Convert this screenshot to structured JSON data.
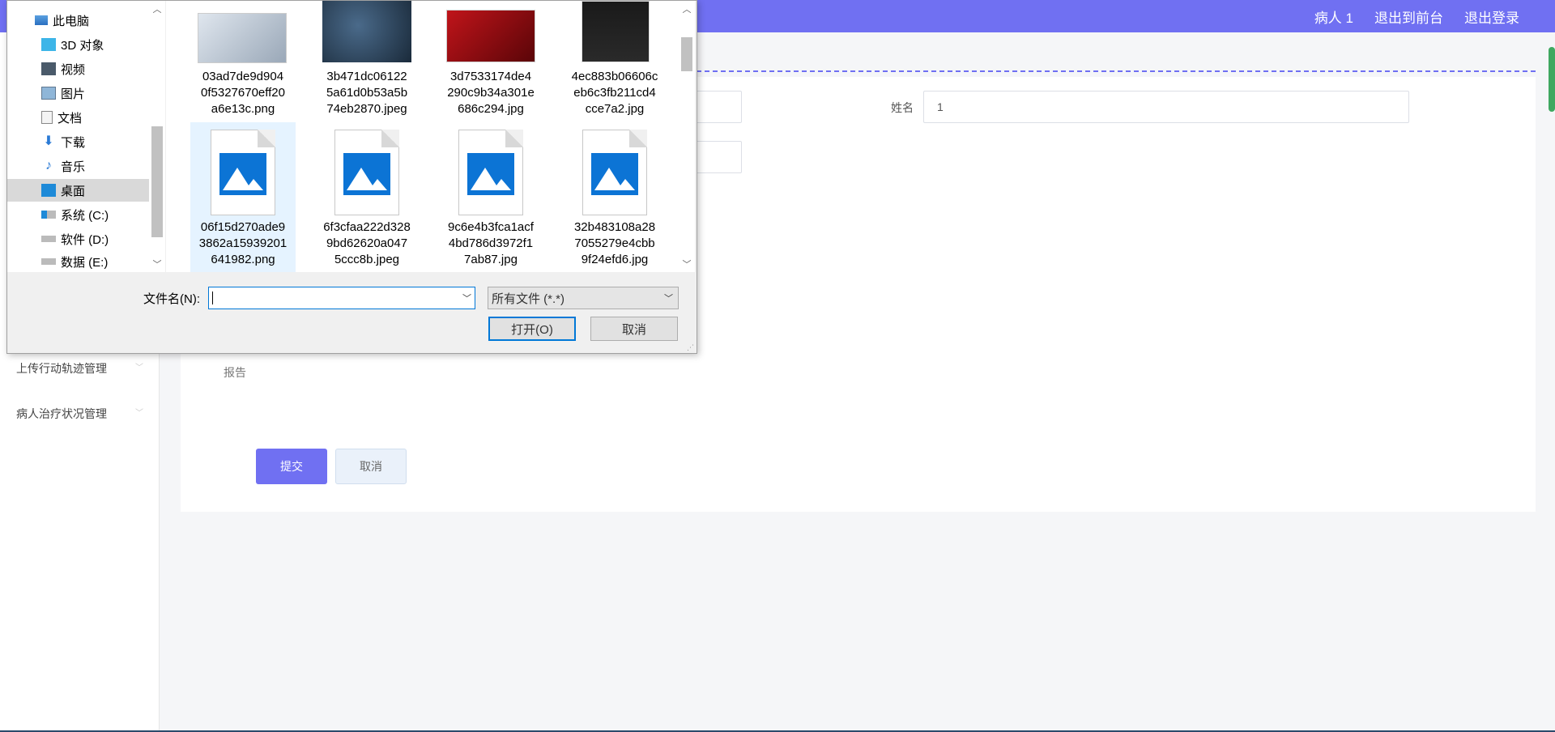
{
  "header": {
    "user": "病人 1",
    "to_front": "退出到前台",
    "logout": "退出登录"
  },
  "sidebar": {
    "items": [
      {
        "label": "上传行动轨迹管理"
      },
      {
        "label": "病人治疗状况管理"
      }
    ]
  },
  "form": {
    "name_label": "姓名",
    "name_value": "1",
    "report_label": "报告",
    "submit": "提交",
    "cancel": "取消"
  },
  "dialog": {
    "nav": [
      {
        "label": "此电脑",
        "icon": "pc-icon"
      },
      {
        "label": "3D 对象",
        "icon": "cube-3d-icon"
      },
      {
        "label": "视频",
        "icon": "video-icon"
      },
      {
        "label": "图片",
        "icon": "picture-icon"
      },
      {
        "label": "文档",
        "icon": "document-icon"
      },
      {
        "label": "下载",
        "icon": "download-icon"
      },
      {
        "label": "音乐",
        "icon": "music-icon"
      },
      {
        "label": "桌面",
        "icon": "desktop-icon"
      },
      {
        "label": "系统 (C:)",
        "icon": "drive-c-icon"
      },
      {
        "label": "软件 (D:)",
        "icon": "drive-icon"
      },
      {
        "label": "数据 (E:)",
        "icon": "drive-icon"
      }
    ],
    "files": [
      {
        "name": "03ad7de9d904\n0f5327670eff20\na6e13c.png",
        "thumb": "phone-photo"
      },
      {
        "name": "3b471dc06122\n5a61d0b53a5b\n74eb2870.jpeg",
        "thumb": "shoe-photo"
      },
      {
        "name": "3d7533174de4\n290c9b34a301e\n686c294.jpg",
        "thumb": "red-photo"
      },
      {
        "name": "4ec883b06606c\neb6c3fb211cd4\ncce7a2.jpg",
        "thumb": "shirt-photo"
      },
      {
        "name": "06f15d270ade9\n3862a15939201\n641982.png",
        "thumb": "image-icon"
      },
      {
        "name": "6f3cfaa222d328\n9bd62620a047\n5ccc8b.jpeg",
        "thumb": "image-icon"
      },
      {
        "name": "9c6e4b3fca1acf\n4bd786d3972f1\n7ab87.jpg",
        "thumb": "image-icon"
      },
      {
        "name": "32b483108a28\n7055279e4cbb\n9f24efd6.jpg",
        "thumb": "image-icon"
      }
    ],
    "filename_label": "文件名(N):",
    "filename_value": "",
    "filetype": "所有文件 (*.*)",
    "open": "打开(O)",
    "cancel": "取消"
  },
  "colors": {
    "accent": "#7070f2",
    "dialog_bg": "#f0f0f0",
    "file_icon": "#0c74d5"
  }
}
